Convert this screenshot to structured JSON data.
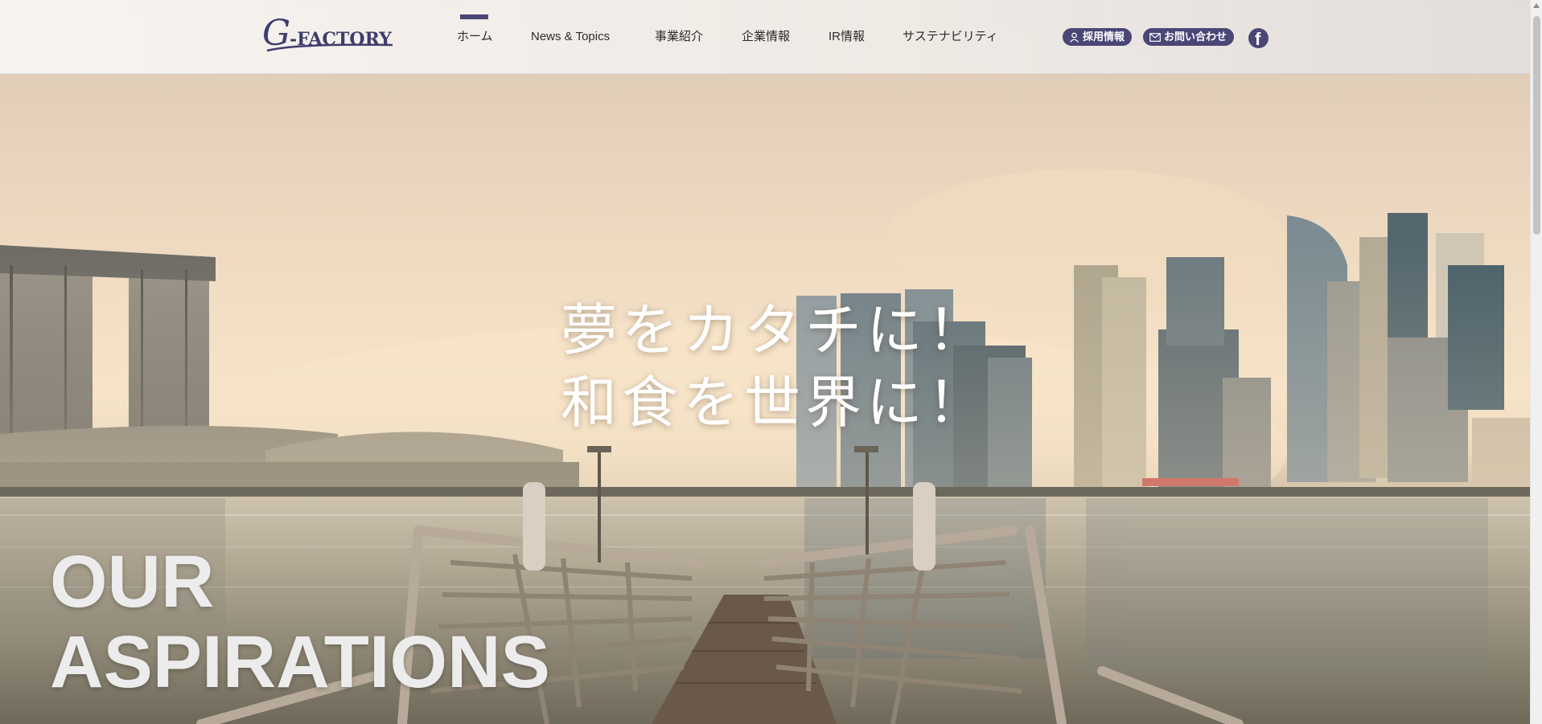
{
  "brand": {
    "logo_initial": "G",
    "logo_text": "-FACTORY",
    "accent_color": "#4a4675"
  },
  "nav": {
    "items": [
      {
        "label": "ホーム",
        "active": true
      },
      {
        "label": "News & Topics",
        "active": false
      },
      {
        "label": "事業紹介",
        "active": false
      },
      {
        "label": "企業情報",
        "active": false
      },
      {
        "label": "IR情報",
        "active": false
      },
      {
        "label": "サステナビリティ",
        "active": false
      }
    ],
    "recruit_label": "採用情報",
    "recruit_icon": "person-icon",
    "contact_label": "お問い合わせ",
    "contact_icon": "mail-icon",
    "social_icon": "facebook-icon",
    "social_glyph": "f"
  },
  "hero": {
    "catch_line1": "夢をカタチに！",
    "catch_line2": "和食を世界に！",
    "aspire_line1": "OUR",
    "aspire_line2": "ASPIRATIONS"
  }
}
